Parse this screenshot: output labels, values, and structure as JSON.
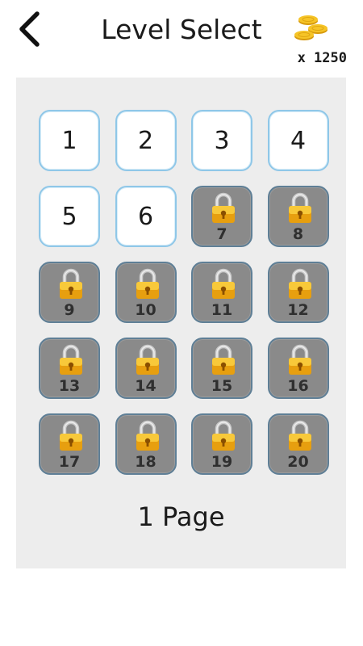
{
  "header": {
    "title": "Level Select",
    "coins_text": "x 1250",
    "back_icon": "chevron-left-icon",
    "coins_icon": "coin-stack-icon"
  },
  "levels": [
    {
      "label": "1",
      "locked": false
    },
    {
      "label": "2",
      "locked": false
    },
    {
      "label": "3",
      "locked": false
    },
    {
      "label": "4",
      "locked": false
    },
    {
      "label": "5",
      "locked": false
    },
    {
      "label": "6",
      "locked": false
    },
    {
      "label": "7",
      "locked": true
    },
    {
      "label": "8",
      "locked": true
    },
    {
      "label": "9",
      "locked": true
    },
    {
      "label": "10",
      "locked": true
    },
    {
      "label": "11",
      "locked": true
    },
    {
      "label": "12",
      "locked": true
    },
    {
      "label": "13",
      "locked": true
    },
    {
      "label": "14",
      "locked": true
    },
    {
      "label": "15",
      "locked": true
    },
    {
      "label": "16",
      "locked": true
    },
    {
      "label": "17",
      "locked": true
    },
    {
      "label": "18",
      "locked": true
    },
    {
      "label": "19",
      "locked": true
    },
    {
      "label": "20",
      "locked": true
    }
  ],
  "page": {
    "label": "1 Page"
  },
  "colors": {
    "open_tile_border": "#8fc7e8",
    "locked_tile_fill": "#8a8a8a",
    "lock_gold": "#f2b21f",
    "panel_bg": "#ededed"
  }
}
